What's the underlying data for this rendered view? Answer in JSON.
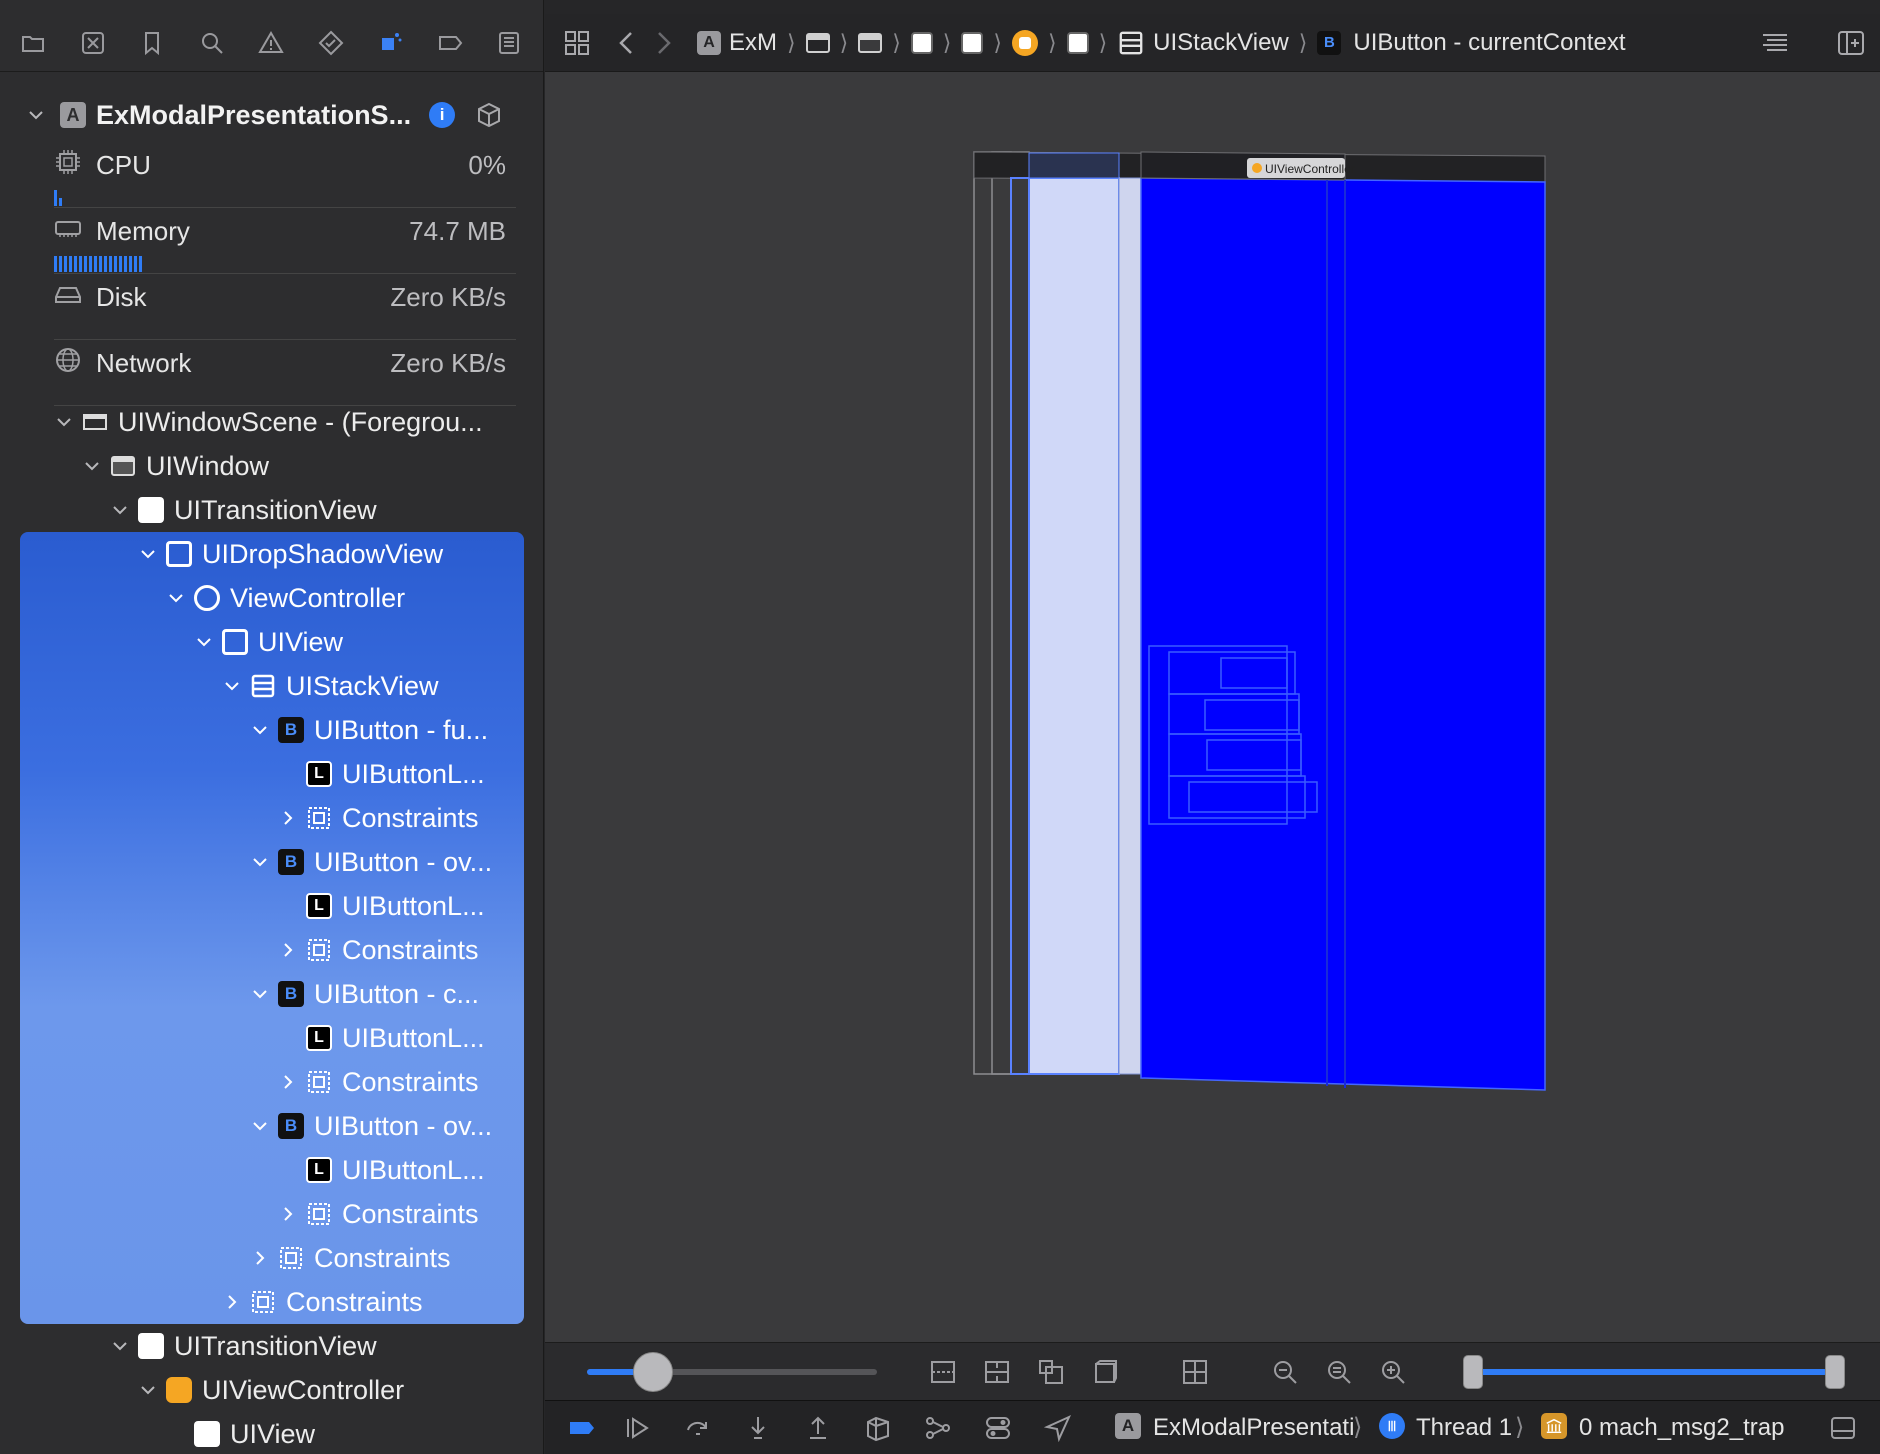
{
  "navigator": {
    "process": {
      "name": "ExModalPresentationS...",
      "info_badge": "i"
    },
    "gauges": [
      {
        "label": "CPU",
        "value": "0%",
        "icon": "cpu-icon"
      },
      {
        "label": "Memory",
        "value": "74.7 MB",
        "icon": "memory-icon"
      },
      {
        "label": "Disk",
        "value": "Zero KB/s",
        "icon": "disk-icon"
      },
      {
        "label": "Network",
        "value": "Zero KB/s",
        "icon": "network-icon"
      }
    ],
    "tree": [
      {
        "label": "UIWindowScene - (Foregrou...",
        "icon": "window-scene-icon"
      },
      {
        "label": "UIWindow",
        "icon": "window-icon"
      },
      {
        "label": "UITransitionView",
        "icon": "view-icon"
      },
      {
        "label": "UIDropShadowView",
        "icon": "view-icon"
      },
      {
        "label": "ViewController",
        "icon": "view-controller-icon"
      },
      {
        "label": "UIView",
        "icon": "view-icon"
      },
      {
        "label": "UIStackView",
        "icon": "stack-view-icon"
      },
      {
        "label": "UIButton - fu...",
        "icon": "button-icon"
      },
      {
        "label": "UIButtonL...",
        "icon": "label-icon"
      },
      {
        "label": "Constraints",
        "icon": "constraints-icon"
      },
      {
        "label": "UIButton - ov...",
        "icon": "button-icon"
      },
      {
        "label": "UIButtonL...",
        "icon": "label-icon"
      },
      {
        "label": "Constraints",
        "icon": "constraints-icon"
      },
      {
        "label": "UIButton - c...",
        "icon": "button-icon"
      },
      {
        "label": "UIButtonL...",
        "icon": "label-icon"
      },
      {
        "label": "Constraints",
        "icon": "constraints-icon"
      },
      {
        "label": "UIButton - ov...",
        "icon": "button-icon"
      },
      {
        "label": "UIButtonL...",
        "icon": "label-icon"
      },
      {
        "label": "Constraints",
        "icon": "constraints-icon"
      },
      {
        "label": "Constraints",
        "icon": "constraints-icon"
      },
      {
        "label": "Constraints",
        "icon": "constraints-icon"
      },
      {
        "label": "UITransitionView",
        "icon": "view-icon"
      },
      {
        "label": "UIViewController",
        "icon": "view-controller-icon"
      },
      {
        "label": "UIView",
        "icon": "view-icon"
      }
    ]
  },
  "jumpbar": {
    "app_short": "ExM",
    "stack_view": "UIStackView",
    "button_badge": "B",
    "button": "UIButton - currentContext"
  },
  "canvas": {
    "vc_tag": "UIViewController"
  },
  "debugbar": {
    "target": "ExModalPresentati",
    "thread": "Thread 1",
    "frame": "0 mach_msg2_trap"
  },
  "badges": {
    "button": "B",
    "label": "L"
  },
  "colors": {
    "accent": "#2f7cf6",
    "selection": "#3b6ee0",
    "preview_blue": "#0000ff",
    "lavender": "#d0d8f8"
  }
}
